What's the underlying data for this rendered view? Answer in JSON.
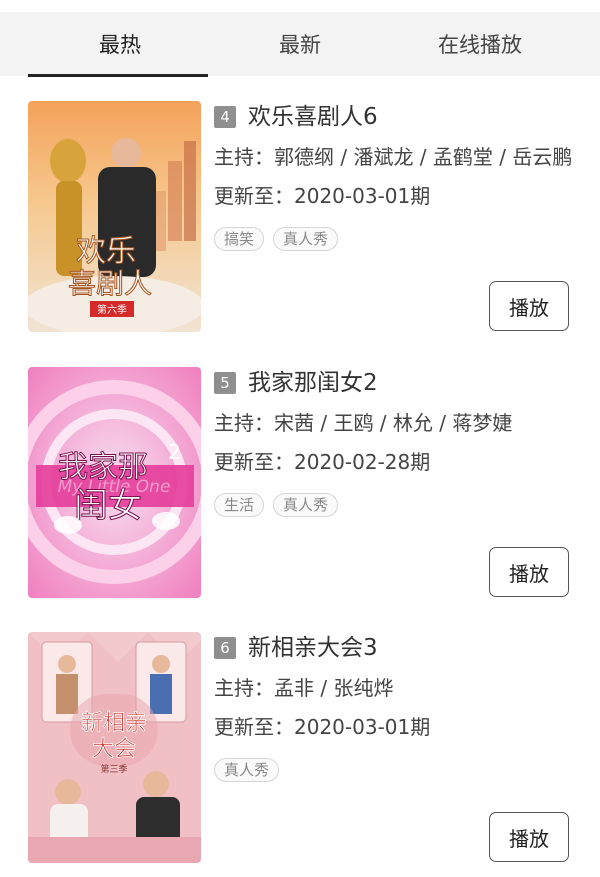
{
  "tabs": [
    {
      "label": "最热",
      "active": true
    },
    {
      "label": "最新",
      "active": false
    },
    {
      "label": "在线播放",
      "active": false
    }
  ],
  "shows": [
    {
      "rank": "4",
      "title": "欢乐喜剧人6",
      "host": "主持：郭德纲 / 潘斌龙 / 孟鹤堂 / 岳云鹏",
      "update": "更新至：2020-03-01期",
      "tags": [
        "搞笑",
        "真人秀"
      ],
      "play_label": "播放",
      "poster_text": [
        "欢乐",
        "喜剧人",
        "第六季"
      ]
    },
    {
      "rank": "5",
      "title": "我家那闺女2",
      "host": "主持：宋茜 / 王鸥 / 林允 / 蒋梦婕",
      "update": "更新至：2020-02-28期",
      "tags": [
        "生活",
        "真人秀"
      ],
      "play_label": "播放",
      "poster_text": [
        "我家那",
        "闺女",
        "2",
        "My Little One"
      ]
    },
    {
      "rank": "6",
      "title": "新相亲大会3",
      "host": "主持：孟非 / 张纯烨",
      "update": "更新至：2020-03-01期",
      "tags": [
        "真人秀"
      ],
      "play_label": "播放",
      "poster_text": [
        "新相亲",
        "大会",
        "第三季"
      ]
    }
  ],
  "colors": {
    "tab_bar_bg": "#f3f3f3",
    "rank_badge": "#8f8f8f",
    "accent_pink": "#e84a9a"
  }
}
